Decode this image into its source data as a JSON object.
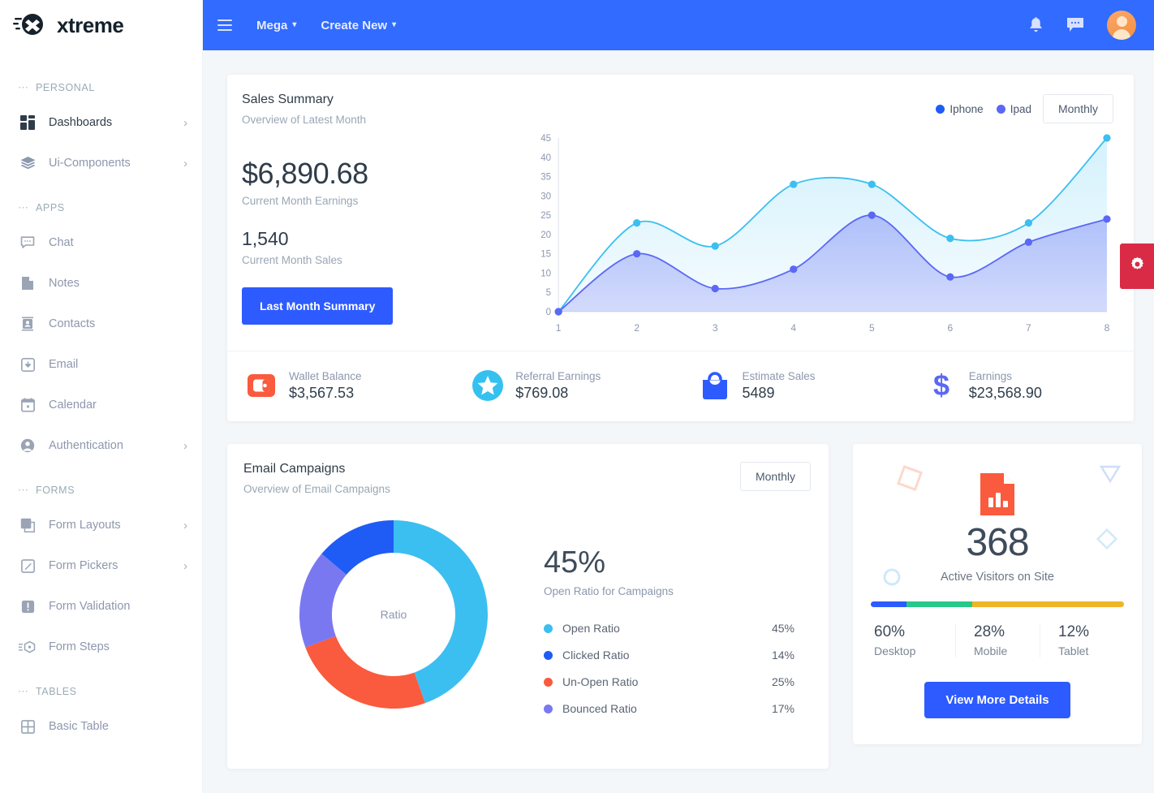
{
  "brand": {
    "name": "xtreme",
    "logo_icon": "xtreme-logo-icon"
  },
  "topbar": {
    "menu_icon": "hamburger-icon",
    "links": [
      {
        "label": "Mega",
        "caret": "▾"
      },
      {
        "label": "Create New",
        "caret": "▾"
      }
    ],
    "notification_icon": "bell-icon",
    "messages_icon": "chat-bubble-icon",
    "avatar_icon": "user-avatar"
  },
  "sidebar": {
    "sections": [
      {
        "caption": "PERSONAL",
        "items": [
          {
            "label": "Dashboards",
            "icon": "dashboard-grid-icon",
            "chevron": "›",
            "active": true
          },
          {
            "label": "Ui-Components",
            "icon": "layers-icon",
            "chevron": "›",
            "active": false
          }
        ]
      },
      {
        "caption": "APPS",
        "items": [
          {
            "label": "Chat",
            "icon": "chat-icon",
            "chevron": "",
            "active": false
          },
          {
            "label": "Notes",
            "icon": "note-icon",
            "chevron": "",
            "active": false
          },
          {
            "label": "Contacts",
            "icon": "contacts-icon",
            "chevron": "",
            "active": false
          },
          {
            "label": "Email",
            "icon": "email-icon",
            "chevron": "",
            "active": false
          },
          {
            "label": "Calendar",
            "icon": "calendar-icon",
            "chevron": "",
            "active": false
          },
          {
            "label": "Authentication",
            "icon": "user-circle-icon",
            "chevron": "›",
            "active": false
          }
        ]
      },
      {
        "caption": "FORMS",
        "items": [
          {
            "label": "Form Layouts",
            "icon": "form-layout-icon",
            "chevron": "›",
            "active": false
          },
          {
            "label": "Form Pickers",
            "icon": "form-picker-icon",
            "chevron": "›",
            "active": false
          },
          {
            "label": "Form Validation",
            "icon": "form-validation-icon",
            "chevron": "",
            "active": false
          },
          {
            "label": "Form Steps",
            "icon": "form-steps-icon",
            "chevron": "",
            "active": false
          }
        ]
      },
      {
        "caption": "TABLES",
        "items": [
          {
            "label": "Basic Table",
            "icon": "table-icon",
            "chevron": "",
            "active": false
          }
        ]
      }
    ]
  },
  "sales_summary": {
    "title": "Sales Summary",
    "subtitle": "Overview of Latest Month",
    "earnings_value": "$6,890.68",
    "earnings_label": "Current Month Earnings",
    "sales_value": "1,540",
    "sales_label": "Current Month Sales",
    "button_label": "Last Month Summary",
    "period_selected": "Monthly",
    "stats": [
      {
        "label": "Wallet Balance",
        "value": "$3,567.53",
        "icon": "wallet-icon",
        "color": "#fa5a3d"
      },
      {
        "label": "Referral Earnings",
        "value": "$769.08",
        "icon": "star-icon",
        "color": "#35c1f0"
      },
      {
        "label": "Estimate Sales",
        "value": "5489",
        "icon": "shopping-bag-icon",
        "color": "#2d5bff"
      },
      {
        "label": "Earnings",
        "value": "$23,568.90",
        "icon": "dollar-icon",
        "color": "#5b68f5"
      }
    ]
  },
  "email_campaigns": {
    "title": "Email Campaigns",
    "subtitle": "Overview of Email Campaigns",
    "period_selected": "Monthly",
    "donut_center": "Ratio",
    "headline_value": "45%",
    "headline_label": "Open Ratio for Campaigns",
    "legend": [
      {
        "label": "Open Ratio",
        "value": "45%",
        "color": "#3bbff0"
      },
      {
        "label": "Clicked Ratio",
        "value": "14%",
        "color": "#1f5bf5"
      },
      {
        "label": "Un-Open Ratio",
        "value": "25%",
        "color": "#fa5a3d"
      },
      {
        "label": "Bounced Ratio",
        "value": "17%",
        "color": "#7a78f0"
      }
    ]
  },
  "visitors": {
    "icon": "report-chart-icon",
    "count": "368",
    "label": "Active Visitors on Site",
    "button_label": "View More Details",
    "breakdown": [
      {
        "pct": "60%",
        "device": "Desktop",
        "color": "#2d5bff",
        "bar_pct": 14
      },
      {
        "pct": "28%",
        "device": "Mobile",
        "color": "#28c988",
        "bar_pct": 26
      },
      {
        "pct": "12%",
        "device": "Tablet",
        "color": "#f0b429",
        "bar_pct": 60
      }
    ]
  },
  "settings_tab": {
    "icon": "gear-icon",
    "color": "#d92b46"
  },
  "chart_data": {
    "type": "area",
    "title": "Sales Summary",
    "subtitle": "Overview of Latest Month",
    "x": [
      1,
      2,
      3,
      4,
      5,
      6,
      7,
      8
    ],
    "xlabel": "",
    "ylabel": "",
    "ylim": [
      0,
      45
    ],
    "yticks": [
      0,
      5,
      10,
      15,
      20,
      25,
      30,
      35,
      40,
      45
    ],
    "grid": false,
    "legend_position": "top-right",
    "series": [
      {
        "name": "Iphone",
        "color": "#3bbff0",
        "values": [
          0,
          23,
          17,
          33,
          33,
          19,
          23,
          45
        ]
      },
      {
        "name": "Ipad",
        "color": "#5b68f5",
        "values": [
          0,
          15,
          6,
          11,
          25,
          9,
          18,
          24
        ]
      }
    ]
  },
  "donut_chart": {
    "type": "pie",
    "title": "Email Campaigns",
    "center_label": "Ratio",
    "categories": [
      "Open Ratio",
      "Clicked Ratio",
      "Un-Open Ratio",
      "Bounced Ratio"
    ],
    "values": [
      45,
      14,
      25,
      17
    ],
    "colors": [
      "#3bbff0",
      "#1f5bf5",
      "#fa5a3d",
      "#7a78f0"
    ],
    "draw_order": [
      "Open Ratio",
      "Un-Open Ratio",
      "Bounced Ratio",
      "Clicked Ratio"
    ]
  }
}
